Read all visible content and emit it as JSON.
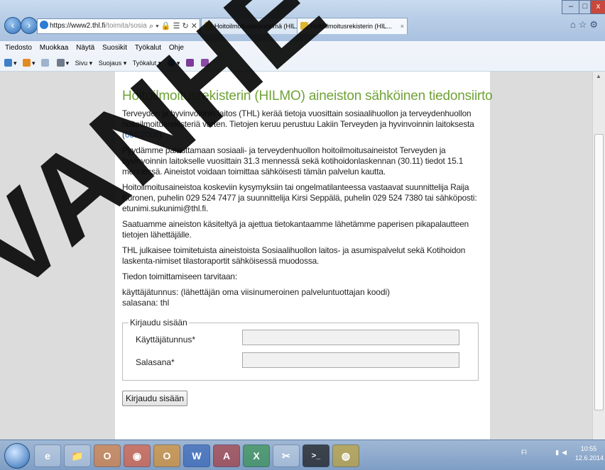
{
  "browser": {
    "url_host": "https://www2.thl.fi",
    "url_rest": "/toimita/sosiaalihilm",
    "address_controls": "⌕ ▾ 🔒 ☰ ↻ ✕",
    "tabs": [
      {
        "label": "Hoitoilmoitusjärjestelmä (HIL...",
        "active": false
      },
      {
        "label": "Hoitoilmoitusrekisterin (HIL...",
        "close": "×",
        "active": true
      }
    ],
    "window_buttons": {
      "minimize": "–",
      "maximize": "□",
      "close": "x"
    }
  },
  "menu": {
    "items": [
      "Tiedosto",
      "Muokkaa",
      "Näytä",
      "Suosikit",
      "Työkalut",
      "Ohje"
    ]
  },
  "commandbar": {
    "items": [
      "Sivu ▾",
      "Suojaus ▾",
      "Työkalut ▾"
    ]
  },
  "page": {
    "title": "Hoitoilmoitusrekisterin (HILMO) aineiston sähköinen tiedonsiirto",
    "para1_before_link": "Terveyden ja hyvinvoinnin laitos (THL) kerää tietoja vuosittain sosiaalihuollon ja terveydenhuollon hoitoilmoitusrekisteriä varten. Tietojen keruu perustuu Lakiin Terveyden ja hyvinvoinnin laitoksesta (",
    "para1_link": "668/2008",
    "para1_after_link": ").",
    "para2": "Pyydämme palauttamaan sosiaali- ja terveydenhuollon hoitoilmoitusaineistot Terveyden ja hyvinvoinnin laitokselle vuosittain 31.3 mennessä sekä kotihoidonlaskennan (30.11) tiedot 15.1 mennessä. Aineistot voidaan toimittaa sähköisesti tämän palvelun kautta.",
    "para3": "Hoitoilmoitusaineistoa koskeviin kysymyksiin tai ongelmatilanteessa vastaavat suunnittelija Raija Kuronen, puhelin 029 524 7477 ja suunnittelija Kirsi Seppälä, puhelin 029 524 7380 tai sähköposti: etunimi.sukunimi@thl.fi.",
    "para4": "Saatuamme aineiston käsiteltyä ja ajettua tietokantaamme lähetämme paperisen pikapalautteen tietojen lähettäjälle.",
    "para5": "THL julkaisee toimitetuista aineistoista Sosiaalihuollon laitos- ja asumispalvelut sekä Kotihoidon laskenta-nimiset tilastoraportit sähköisessä muodossa.",
    "para6": "Tiedon toimittamiseen tarvitaan:",
    "cred_user": "käyttäjätunnus: (lähettäjän oma viisinumeroinen palveluntuottajan koodi)",
    "cred_pass": "salasana: thl"
  },
  "login": {
    "legend": "Kirjaudu sisään",
    "username_label": "Käyttäjätunnus*",
    "password_label": "Salasana*",
    "username_value": "",
    "password_value": "",
    "submit_label": "Kirjaudu sisään"
  },
  "watermark": "VANHE",
  "taskbar": {
    "apps": [
      "e",
      "📁",
      "O",
      "◉",
      "O",
      "W",
      "A",
      "X",
      "✂",
      ">_",
      "◍"
    ],
    "tray": "FI",
    "time": "10:55",
    "date": "12.6.2014"
  },
  "colors": {
    "title_green": "#6fa336",
    "link_blue": "#2a6db5",
    "page_bg": "#dcdcdc"
  }
}
